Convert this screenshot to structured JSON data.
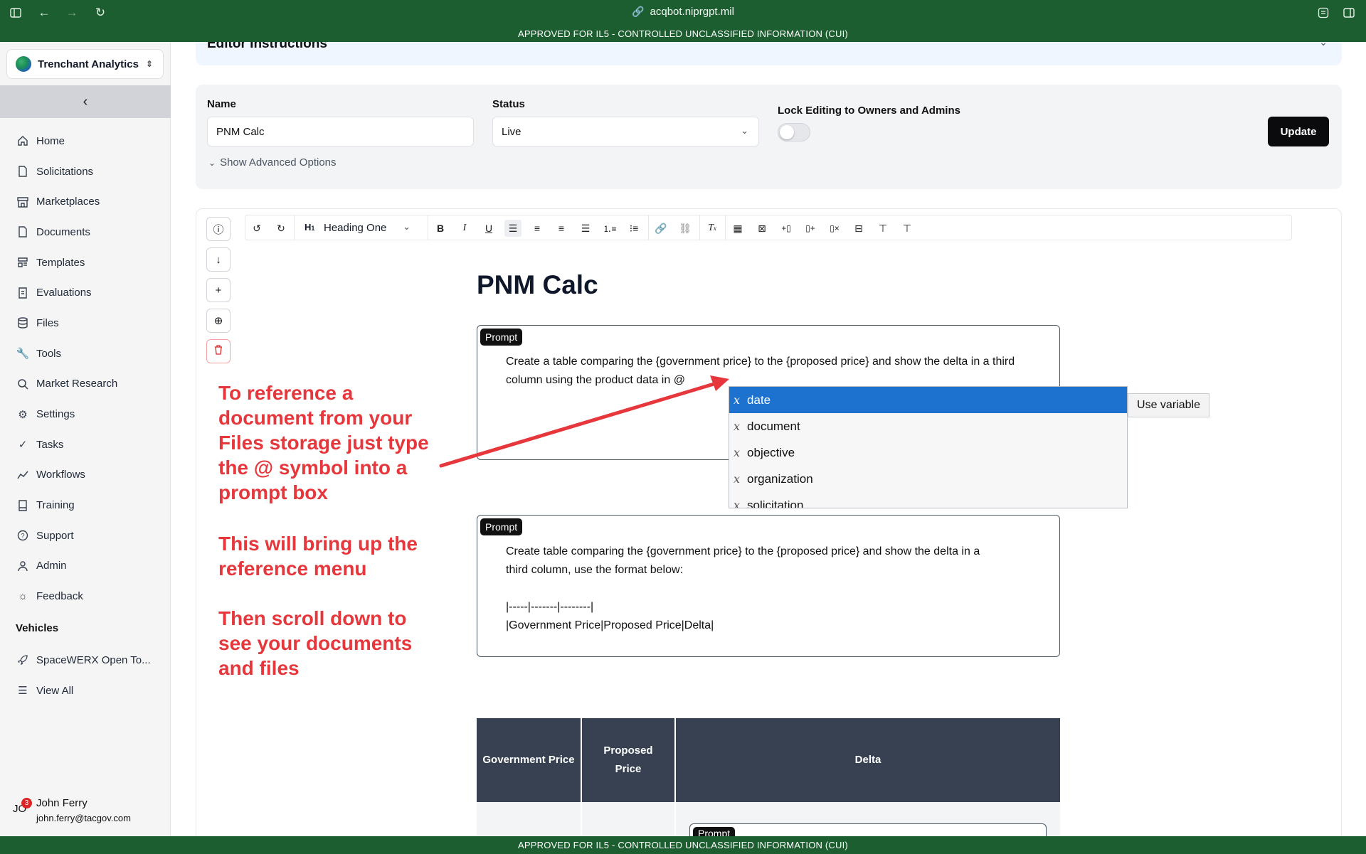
{
  "browser": {
    "url": "acqbot.niprgpt.mil",
    "banner": "APPROVED FOR IL5 - CONTROLLED UNCLASSIFIED INFORMATION (CUI)"
  },
  "sidebar": {
    "org_name": "Trenchant Analytics",
    "items": [
      {
        "label": "Home",
        "icon": "home-icon"
      },
      {
        "label": "Solicitations",
        "icon": "document-icon"
      },
      {
        "label": "Marketplaces",
        "icon": "store-icon"
      },
      {
        "label": "Documents",
        "icon": "document-icon"
      },
      {
        "label": "Templates",
        "icon": "template-icon"
      },
      {
        "label": "Evaluations",
        "icon": "evaluation-icon"
      },
      {
        "label": "Files",
        "icon": "database-icon"
      },
      {
        "label": "Tools",
        "icon": "wrench-icon"
      },
      {
        "label": "Market Research",
        "icon": "search-icon"
      },
      {
        "label": "Settings",
        "icon": "gear-icon"
      },
      {
        "label": "Tasks",
        "icon": "check-icon"
      },
      {
        "label": "Workflows",
        "icon": "workflow-icon"
      },
      {
        "label": "Training",
        "icon": "book-icon"
      },
      {
        "label": "Support",
        "icon": "help-icon"
      },
      {
        "label": "Admin",
        "icon": "user-icon"
      },
      {
        "label": "Feedback",
        "icon": "bulb-icon"
      }
    ],
    "vehicles_title": "Vehicles",
    "vehicles": [
      {
        "label": "SpaceWERX Open To...",
        "icon": "rocket-icon"
      },
      {
        "label": "View All",
        "icon": "list-icon"
      }
    ],
    "user": {
      "initials": "JO",
      "badge": "3",
      "name": "John Ferry",
      "email": "john.ferry@tacgov.com"
    }
  },
  "main": {
    "instructions_title": "Editor Instructions",
    "form": {
      "name_label": "Name",
      "name_value": "PNM Calc",
      "status_label": "Status",
      "status_value": "Live",
      "lock_label": "Lock Editing to Owners and Admins",
      "lock_enabled": false,
      "advanced": "Show Advanced Options",
      "update": "Update"
    },
    "toolbar": {
      "heading_select": "Heading One"
    },
    "doc_title": "PNM Calc",
    "prompt1": {
      "tag": "Prompt",
      "text": "Create a table comparing the {government price} to the {proposed price} and show the delta in a third column using the product data in @"
    },
    "variable_menu": {
      "items": [
        "date",
        "document",
        "objective",
        "organization",
        "solicitation"
      ],
      "selected": "date",
      "action": "Use variable"
    },
    "prompt2": {
      "tag": "Prompt",
      "line1": "Create table comparing the {government price} to the {proposed price} and show the delta in a",
      "line2": "third column, use the format below:",
      "line3": "|-----|-------|--------|",
      "line4": "|Government Price|Proposed Price|Delta|"
    },
    "table": {
      "headers": [
        "Government Price",
        "Proposed Price",
        "Delta"
      ],
      "inner_prompt_tag": "Prompt"
    }
  },
  "annotations": {
    "note1": [
      "To reference a",
      "document from your",
      "Files storage just type",
      "the @ symbol into a",
      "prompt box"
    ],
    "note2": [
      "This will bring up the",
      "reference menu"
    ],
    "note3": [
      "Then scroll down to",
      "see your documents",
      "and files"
    ],
    "color": "#e5373c"
  },
  "colors": {
    "chrome_green": "#1c5e2f",
    "menu_selected": "#1d72d0",
    "table_header": "#374151"
  }
}
